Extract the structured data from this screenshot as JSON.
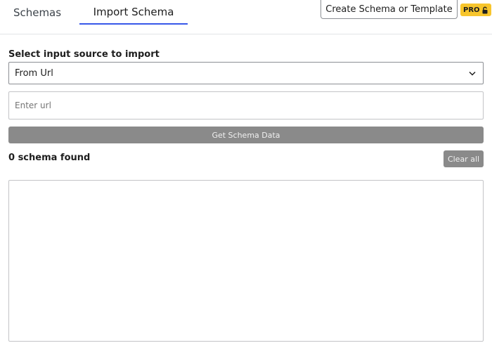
{
  "tabs": [
    {
      "label": "Schemas",
      "active": false
    },
    {
      "label": "Import Schema",
      "active": true
    }
  ],
  "header": {
    "create_button_label": "Create Schema or Template",
    "pro_badge": "PRO",
    "pro_icon": "lock-icon"
  },
  "form": {
    "source_label": "Select input source to import",
    "source_selected": "From Url",
    "source_icon": "chevron-down-icon",
    "url_placeholder": "Enter url",
    "url_value": "",
    "get_button_label": "Get Schema Data"
  },
  "results": {
    "count_text": "0 schema found",
    "clear_button_label": "Clear all"
  },
  "colors": {
    "active_tab_underline": "#3858e9",
    "pro_badge_bg": "#f7c52c",
    "disabled_button_bg": "#8a8a8a"
  }
}
